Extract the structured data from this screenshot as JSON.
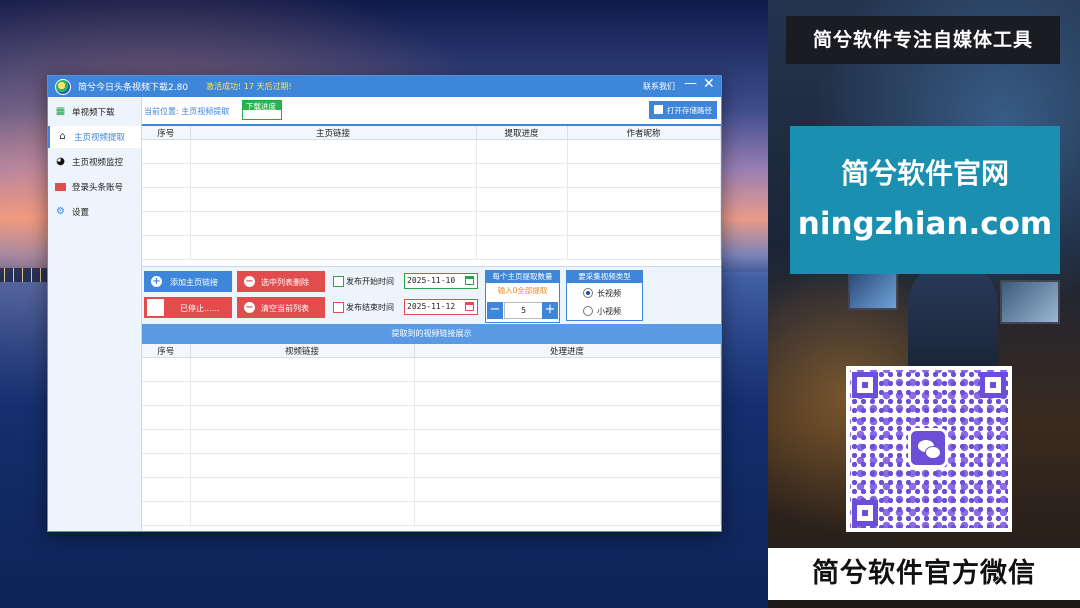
{
  "window": {
    "title": "简兮今日头条视频下载2.80",
    "activation_notice": "激活成功! 17 天后过期!",
    "contact_label": "联系我们",
    "minimize_glyph": "—",
    "close_glyph": "✕"
  },
  "sidebar": {
    "items": [
      {
        "label": "单视频下载",
        "icon": "clapper-icon"
      },
      {
        "label": "主页视频提取",
        "icon": "home-icon"
      },
      {
        "label": "主页视频监控",
        "icon": "monitor-clock-icon"
      },
      {
        "label": "登录头条账号",
        "icon": "toutiao-logo-icon"
      },
      {
        "label": "设置",
        "icon": "gear-icon"
      }
    ]
  },
  "breadcrumb": {
    "text": "当前位置: 主页视频提取",
    "progress_tag": "下载进度"
  },
  "toolbar": {
    "open_folder_label": "打开存储路径"
  },
  "top_table": {
    "columns": [
      "序号",
      "主页链接",
      "提取进度",
      "作者昵称"
    ],
    "rows": []
  },
  "controls": {
    "add_homepage_label": "添加主页链接",
    "delete_selected_label": "选中列表删除",
    "stopped_label": "已停止......",
    "clear_list_label": "清空当前列表",
    "publish_start_label": "发布开始时间",
    "publish_end_label": "发布结束时间",
    "start_date": "2025-11-10",
    "end_date": "2025-11-12",
    "count_header": "每个主页提取数量",
    "count_hint": "输入0全部提取",
    "count_value": "5",
    "minus_glyph": "−",
    "plus_glyph": "+",
    "type_header": "要采集视频类型",
    "type_options": [
      "长视频",
      "小视频"
    ],
    "type_selected": "长视频"
  },
  "section_bar": {
    "label": "提取到的视频链接展示"
  },
  "bottom_table": {
    "columns": [
      "序号",
      "视频链接",
      "处理进度"
    ],
    "rows": []
  },
  "ad": {
    "top_banner": "简兮软件专注自媒体工具",
    "site_title": "简兮软件官网",
    "site_url": "ningzhian.com",
    "bottom_banner": "简兮软件官方微信"
  },
  "colors": {
    "accent": "#3d86d9",
    "danger": "#e24c4c",
    "success": "#2aa34a",
    "ad_cyan": "#1a8fb0"
  }
}
